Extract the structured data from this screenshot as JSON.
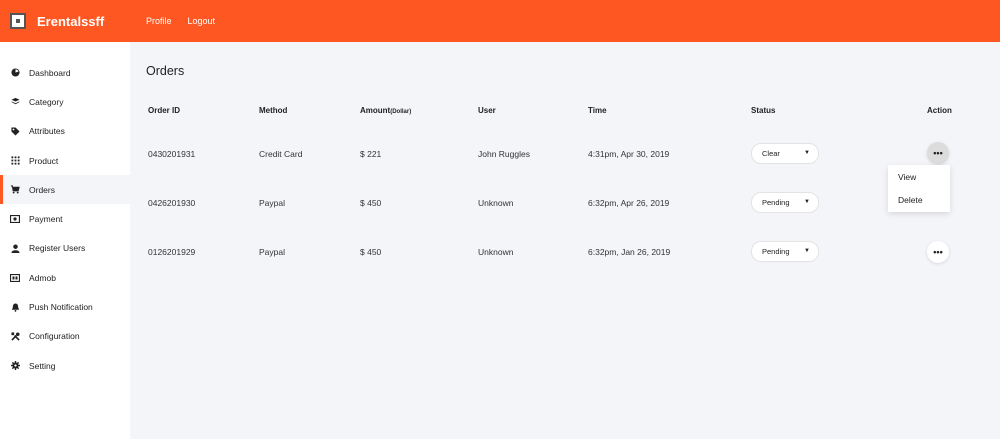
{
  "app": {
    "brand": "Erentalssff"
  },
  "topnav": {
    "profile": "Profile",
    "logout": "Logout"
  },
  "sidebar": {
    "items": [
      {
        "label": "Dashboard",
        "icon": "dashboard-icon"
      },
      {
        "label": "Category",
        "icon": "layers-icon"
      },
      {
        "label": "Attributes",
        "icon": "tag-icon"
      },
      {
        "label": "Product",
        "icon": "grid-icon"
      },
      {
        "label": "Orders",
        "icon": "cart-icon"
      },
      {
        "label": "Payment",
        "icon": "money-icon"
      },
      {
        "label": "Register Users",
        "icon": "user-icon"
      },
      {
        "label": "Admob",
        "icon": "ad-icon"
      },
      {
        "label": "Push Notification",
        "icon": "bell-icon"
      },
      {
        "label": "Configuration",
        "icon": "tools-icon"
      },
      {
        "label": "Setting",
        "icon": "gear-icon"
      }
    ],
    "active": "Orders"
  },
  "page": {
    "title": "Orders"
  },
  "table": {
    "headers": {
      "order_id": "Order ID",
      "method": "Method",
      "amount": "Amount",
      "amount_unit": "(Dollar)",
      "user": "User",
      "time": "Time",
      "status": "Status",
      "action": "Action"
    },
    "rows": [
      {
        "order_id": "0430201931",
        "method": "Credit Card",
        "amount": "$ 221",
        "user": "John Ruggles",
        "time": "4:31pm, Apr 30, 2019",
        "status": "Clear"
      },
      {
        "order_id": "0426201930",
        "method": "Paypal",
        "amount": "$ 450",
        "user": "Unknown",
        "time": "6:32pm, Apr 26, 2019",
        "status": "Pending"
      },
      {
        "order_id": "0126201929",
        "method": "Paypal",
        "amount": "$ 450",
        "user": "Unknown",
        "time": "6:32pm, Jan 26, 2019",
        "status": "Pending"
      }
    ],
    "action_glyph": "•••"
  },
  "action_menu": {
    "view": "View",
    "delete": "Delete"
  },
  "colors": {
    "accent": "#fe5722",
    "background": "#f4f5f9",
    "sidebar": "#ffffff"
  }
}
